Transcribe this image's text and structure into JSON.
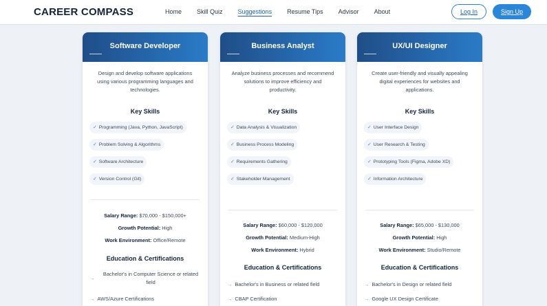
{
  "nav": {
    "logo": "CAREER COMPASS",
    "links": [
      "Home",
      "Skill Quiz",
      "Suggestions",
      "Resume Tips",
      "Advisor",
      "About"
    ],
    "active_link": "Suggestions",
    "login": "Log In",
    "signup": "Sign Up"
  },
  "colors": {
    "accent": "#2a86d8",
    "header_start": "#1f4e87",
    "header_end": "#2a7bc8",
    "check": "#3a8ad6"
  },
  "cards": [
    {
      "title": "Software Developer",
      "description": [
        "Design and develop software applications",
        "using various programming languages and",
        "technologies."
      ],
      "skills_heading": "Key Skills",
      "skills": [
        "Programming (Java, Python, JavaScript)",
        "Problem Solving & Algorithms",
        "Software Architecture",
        "Version Control (Git)"
      ],
      "salary_label": "Salary Range:",
      "salary": "$70,000 - $150,000+",
      "growth_label": "Growth Potential:",
      "growth": "High",
      "env_label": "Work Environment:",
      "env": "Office/Remote",
      "edu_heading": "Education & Certifications",
      "edu": [
        "Bachelor's in Computer Science or related field",
        "AWS/Azure Certifications"
      ]
    },
    {
      "title": "Business Analyst",
      "description": [
        "Analyze business processes and recommend",
        "solutions to improve efficiency and",
        "productivity."
      ],
      "skills_heading": "Key Skills",
      "skills": [
        "Data Analysis & Visualization",
        "Business Process Modeling",
        "Requirements Gathering",
        "Stakeholder Management"
      ],
      "salary_label": "Salary Range:",
      "salary": "$60,000 - $120,000",
      "growth_label": "Growth Potential:",
      "growth": "Medium-High",
      "env_label": "Work Environment:",
      "env": "Hybrid",
      "edu_heading": "Education & Certifications",
      "edu": [
        "Bachelor's in Business or related field",
        "CBAP Certification"
      ]
    },
    {
      "title": "UX/UI Designer",
      "description": [
        "Create user-friendly and visually appealing",
        "digital experiences for websites and",
        "applications."
      ],
      "skills_heading": "Key Skills",
      "skills": [
        "User Interface Design",
        "User Research & Testing",
        "Prototyping Tools (Figma, Adobe XD)",
        "Information Architecture"
      ],
      "salary_label": "Salary Range:",
      "salary": "$65,000 - $130,000",
      "growth_label": "Growth Potential:",
      "growth": "High",
      "env_label": "Work Environment:",
      "env": "Studio/Remote",
      "edu_heading": "Education & Certifications",
      "edu": [
        "Bachelor's in Design or related field",
        "Google UX Design Certificate"
      ]
    }
  ]
}
